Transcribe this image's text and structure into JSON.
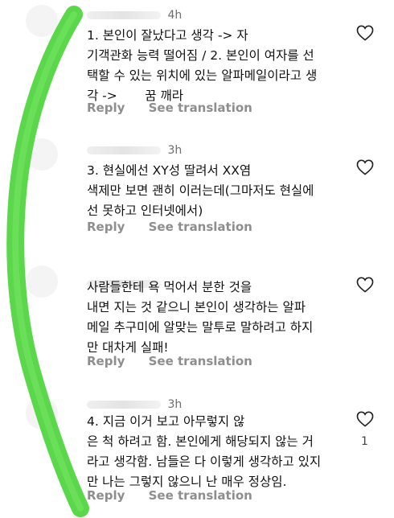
{
  "comments": [
    {
      "time": "4h",
      "text": "1. 본인이 잘났다고 생각 -> 자\n기객관화 능력 떨어짐 / 2. 본인이 여자를 선\n택할 수 있는 위치에 있는 알파메일이라고 생\n각 ->       꿈 깨라",
      "reply": "Reply",
      "translate": "See translation",
      "likes": ""
    },
    {
      "time": "3h",
      "text": "3. 현실에선 XY성 딸려서 XX염\n색제만 보면 괜히 이러는데(그마저도 현실에\n선 못하고 인터넷에서)",
      "reply": "Reply",
      "translate": "See translation",
      "likes": ""
    },
    {
      "time": "",
      "text": "사람들한테 욕 먹어서 분한 것을\n내면 지는 것 같으니 본인이 생각하는 알파\n메일 추구미에 알맞는 말투로 말하려고 하지\n만 대차게 실패!",
      "reply": "Reply",
      "translate": "See translation",
      "likes": ""
    },
    {
      "time": "3h",
      "text": "4. 지금 이거 보고 아무렇지 않\n은 척 하려고 함. 본인에게 해당되지 않는 거\n라고 생각함. 남들은 다 이렇게 생각하고 있지\n만 나는 그렇지 않으니 난 매우 정상임.",
      "reply": "Reply",
      "translate": "See translation",
      "likes": "1"
    }
  ],
  "colors": {
    "highlight_stroke": "#4cd43c",
    "secondary_text": "#8e8e8e"
  },
  "icons": {
    "like": "heart-outline-icon"
  }
}
